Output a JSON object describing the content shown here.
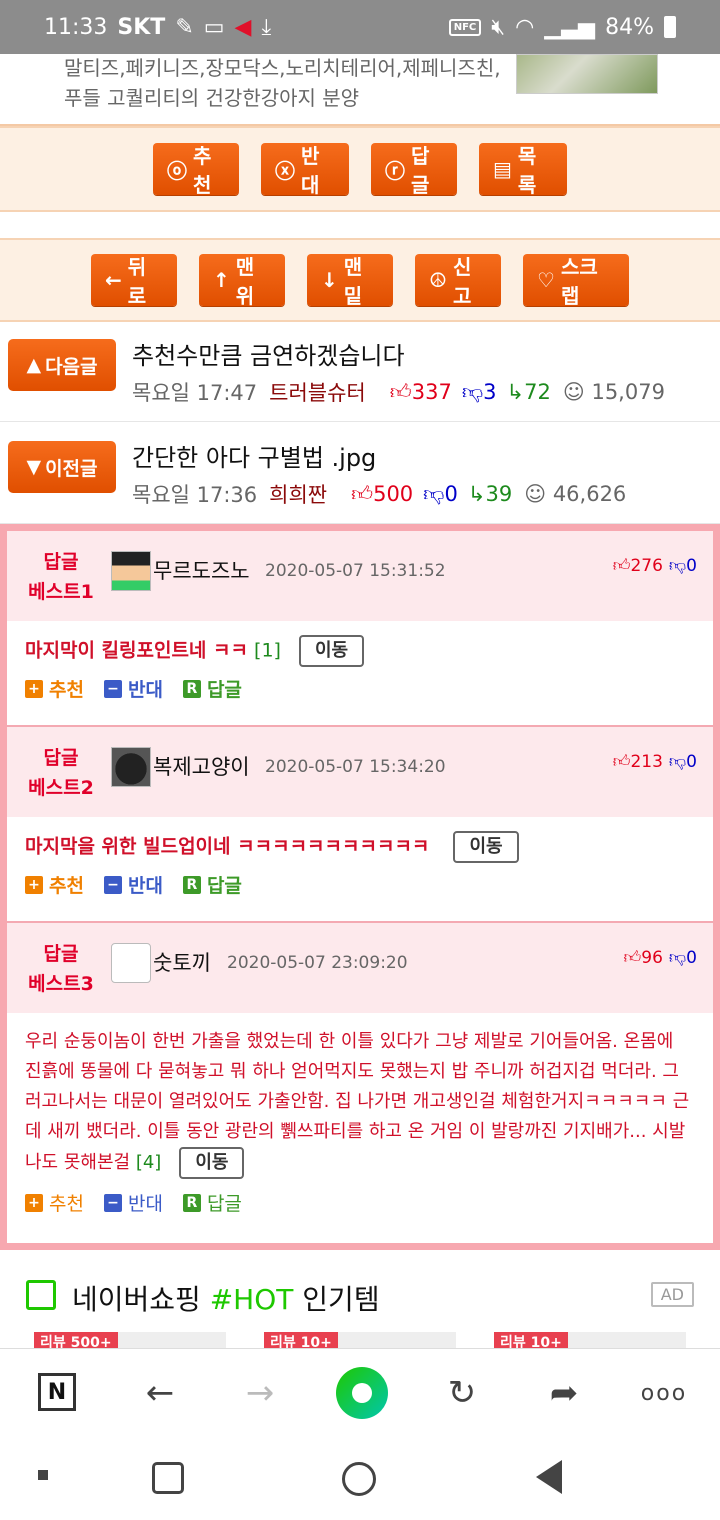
{
  "status_bar": {
    "time": "11:33",
    "carrier": "SKT",
    "nfc": "NFC",
    "battery": "84%"
  },
  "top_ad": {
    "line1": "말티즈,페키니즈,장모닥스,노리치테리어,제페니즈친,",
    "line2": "푸들 고퀄리티의 건강한강아지 분양"
  },
  "action_bar": [
    {
      "icon": "ⓞ",
      "label": "추천"
    },
    {
      "icon": "ⓧ",
      "label": "반대"
    },
    {
      "icon": "ⓡ",
      "label": "답글"
    },
    {
      "icon": "▤",
      "label": "목록"
    }
  ],
  "nav_bar": [
    {
      "icon": "←",
      "label": "뒤로"
    },
    {
      "icon": "↑",
      "label": "맨위"
    },
    {
      "icon": "↓",
      "label": "맨밑"
    },
    {
      "icon": "☮",
      "label": "신고"
    },
    {
      "icon": "♡",
      "label": "스크랩"
    }
  ],
  "next_post": {
    "button": "다음글",
    "arrow": "▲",
    "title": "추천수만큼 금연하겠습니다",
    "time": "목요일 17:47",
    "author": "트러블슈터",
    "up": "337",
    "down": "3",
    "replies": "72",
    "views": "15,079"
  },
  "prev_post": {
    "button": "이전글",
    "arrow": "▼",
    "title": "간단한 아다 구별법 .jpg",
    "time": "목요일 17:36",
    "author": "희희짠",
    "up": "500",
    "down": "0",
    "replies": "39",
    "views": "46,626"
  },
  "best_replies": [
    {
      "label1": "답글",
      "label2": "베스트1",
      "nick": "무르도즈노",
      "date": "2020-05-07 15:31:52",
      "up": "276",
      "down": "0",
      "text": "마지막이 킬링포인트네 ㅋㅋ",
      "count": "[1]",
      "move": "이동"
    },
    {
      "label1": "답글",
      "label2": "베스트2",
      "nick": "복제고양이",
      "date": "2020-05-07 15:34:20",
      "up": "213",
      "down": "0",
      "text": "마지막을 위한 빌드업이네 ㅋㅋㅋㅋㅋㅋㅋㅋㅋㅋㅋ",
      "count": "",
      "move": "이동"
    },
    {
      "label1": "답글",
      "label2": "베스트3",
      "nick": "숫토끼",
      "date": "2020-05-07 23:09:20",
      "up": "96",
      "down": "0",
      "text": "우리 순둥이놈이 한번 가출을 했었는데 한 이틀 있다가 그냥 제발로 기어들어옴. 온몸에 진흙에 똥물에 다 묻혀놓고 뭐 하나 얻어먹지도 못했는지 밥 주니까 허겁지겁 먹더라. 그러고나서는 대문이 열려있어도 가출안함. 집 나가면 개고생인걸 체험한거지ㅋㅋㅋㅋㅋ 근데 새끼 뱄더라. 이틀 동안 광란의 쀍쓰파티를 하고 온 거임 이 발랑까진 기지배가... 시발 나도 못해본걸",
      "count": "[4]",
      "move": "이동"
    }
  ],
  "reply_actions": {
    "rec": "추천",
    "opp": "반대",
    "rep": "답글"
  },
  "naver_shopping": {
    "brand": "네이버쇼핑",
    "hot": "#HOT",
    "suffix": "인기템",
    "ad": "AD",
    "cards": [
      "리뷰 500+",
      "리뷰 10+",
      "리뷰 10+"
    ]
  },
  "browser_bar": {
    "home": "N",
    "back": "←",
    "forward": "→",
    "refresh": "↻",
    "share": "➦",
    "more": "ooo"
  }
}
